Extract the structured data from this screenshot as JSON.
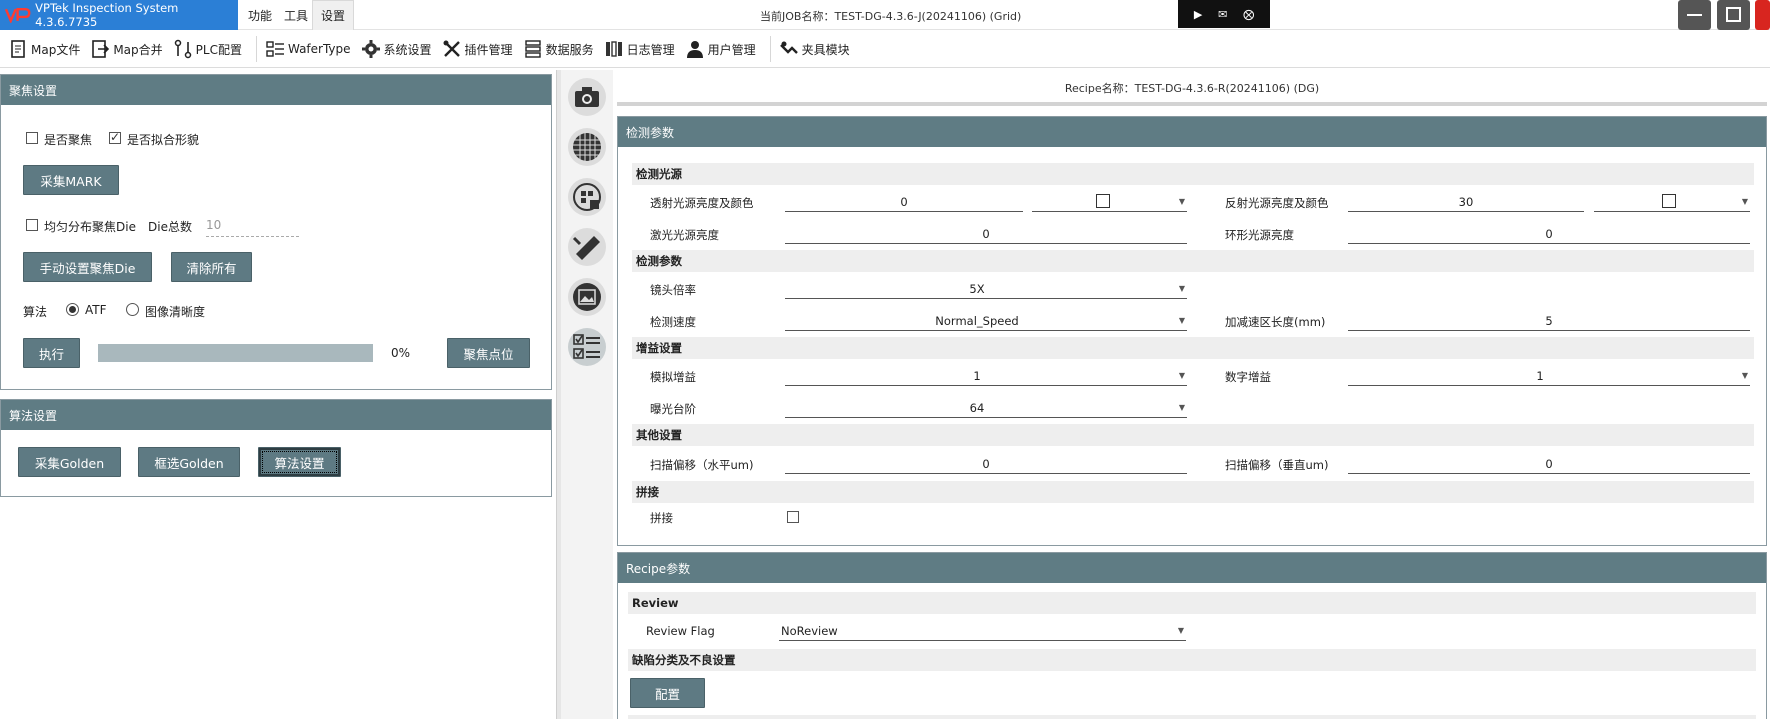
{
  "title_bar": {
    "app_title": "VPTek Inspection System 4.3.6.7735",
    "menus": [
      "功能",
      "工具",
      "设置"
    ],
    "active_menu": "设置",
    "job_title": "当前JOB名称：TEST-DG-4.3.6-J(20241106) (Grid)",
    "accent": "#2b7fd6"
  },
  "toolbar": {
    "items": [
      {
        "label": "Map文件",
        "icon": "map-file-icon"
      },
      {
        "label": "Map合并",
        "icon": "map-merge-icon"
      },
      {
        "label": "PLC配置",
        "icon": "plc-config-icon"
      },
      {
        "label": "WaferType",
        "icon": "wafer-type-icon"
      },
      {
        "label": "系统设置",
        "icon": "gear-icon"
      },
      {
        "label": "插件管理",
        "icon": "tools-icon"
      },
      {
        "label": "数据服务",
        "icon": "database-icon"
      },
      {
        "label": "日志管理",
        "icon": "book-icon"
      },
      {
        "label": "用户管理",
        "icon": "user-icon"
      },
      {
        "label": "夹具模块",
        "icon": "fixture-icon"
      }
    ]
  },
  "focus_panel": {
    "title": "聚焦设置",
    "chk_focus": {
      "label": "是否聚焦",
      "checked": false
    },
    "chk_fit": {
      "label": "是否拟合形貌",
      "checked": true
    },
    "collect_mark": "采集MARK",
    "chk_uniform": {
      "label": "均匀分布聚焦Die",
      "checked": false
    },
    "die_total_label": "Die总数",
    "die_total_value": "10",
    "manual_focus_die": "手动设置聚焦Die",
    "clear_all": "清除所有",
    "algo_label": "算法",
    "radio_atf": {
      "label": "ATF",
      "selected": true
    },
    "radio_clarity": {
      "label": "图像清晰度",
      "selected": false
    },
    "execute": "执行",
    "progress": 0,
    "progress_text": "0%",
    "focus_point": "聚焦点位"
  },
  "algo_panel": {
    "title": "算法设置",
    "collect_golden": "采集Golden",
    "select_golden": "框选Golden",
    "algo_settings": "算法设置"
  },
  "rail": {
    "icons": [
      "camera-icon",
      "wafer-grid-icon",
      "wafer-map-icon",
      "ruler-icon",
      "image-icon",
      "checklist-icon"
    ],
    "active": "checklist-icon"
  },
  "recipe": {
    "title": "Recipe名称：TEST-DG-4.3.6-R(20241106) (DG)"
  },
  "detect_panel": {
    "title": "检测参数",
    "sections": {
      "light": "检测光源",
      "detect": "检测参数",
      "gain": "增益设置",
      "other": "其他设置",
      "stitch": "拼接"
    },
    "fields": {
      "trans_light": {
        "label": "透射光源亮度及颜色",
        "value": "0"
      },
      "refl_light": {
        "label": "反射光源亮度及颜色",
        "value": "30"
      },
      "laser_light": {
        "label": "激光光源亮度",
        "value": "0"
      },
      "ring_light": {
        "label": "环形光源亮度",
        "value": "0"
      },
      "lens": {
        "label": "镜头倍率",
        "value": "5X"
      },
      "speed": {
        "label": "检测速度",
        "value": "Normal_Speed"
      },
      "accel_len": {
        "label": "加减速区长度(mm)",
        "value": "5"
      },
      "analog_gain": {
        "label": "模拟增益",
        "value": "1"
      },
      "digital_gain": {
        "label": "数字增益",
        "value": "1"
      },
      "exposure": {
        "label": "曝光台阶",
        "value": "64"
      },
      "scan_offset_h": {
        "label": "扫描偏移（水平um)",
        "value": "0"
      },
      "scan_offset_v": {
        "label": "扫描偏移（垂直um)",
        "value": "0"
      },
      "stitch": {
        "label": "拼接",
        "checked": false
      }
    }
  },
  "recipe_panel": {
    "title": "Recipe参数",
    "review_section": "Review",
    "review_flag": {
      "label": "Review Flag",
      "value": "NoReview"
    },
    "defect_section": "缺陷分类及不良设置",
    "config": "配置"
  },
  "colors": {
    "panel_header": "#5f7c84",
    "button": "#5e7a83"
  }
}
